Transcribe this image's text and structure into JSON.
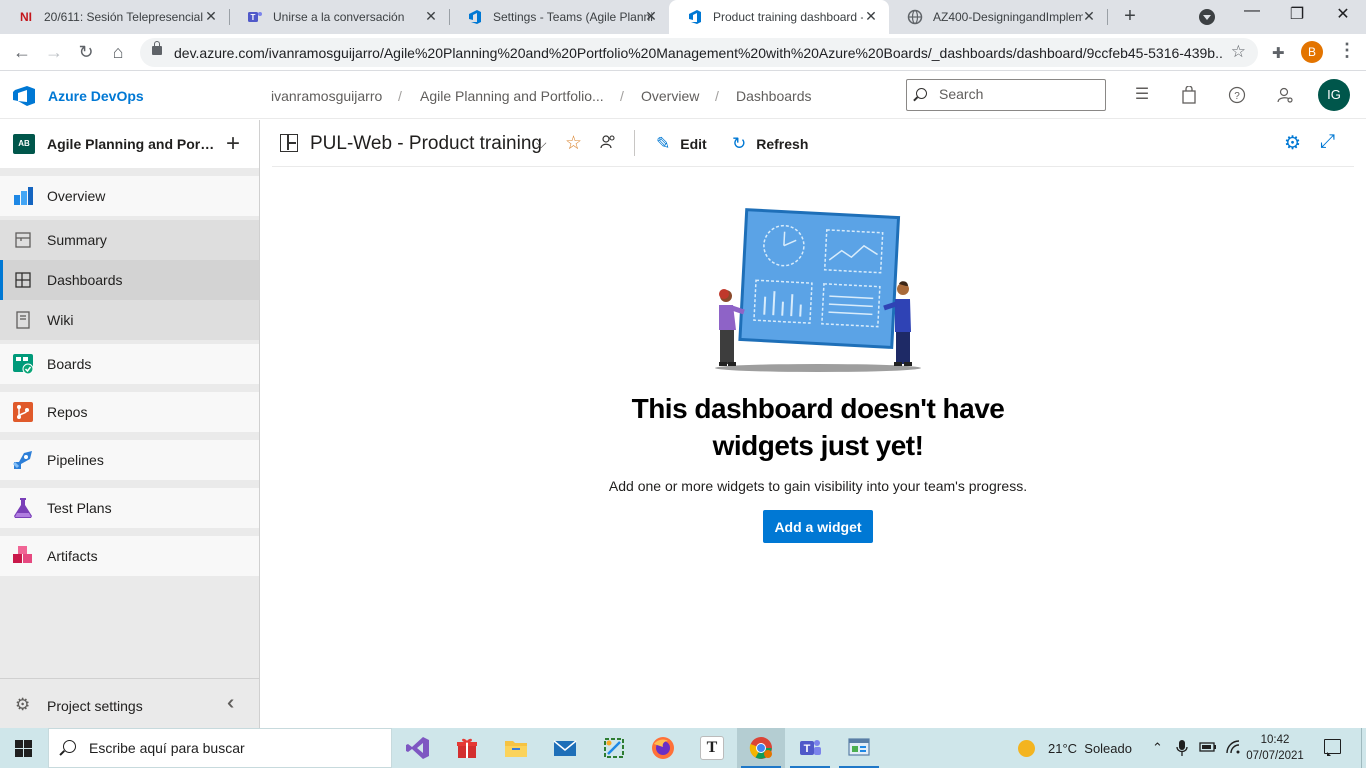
{
  "browser": {
    "tabs": [
      {
        "title": "20/611: Sesión Telepresencial",
        "icon": "notion-like-NI-icon",
        "favicon_text": "NI"
      },
      {
        "title": "Unirse a la conversación",
        "icon": "teams-icon"
      },
      {
        "title": "Settings - Teams (Agile Planni",
        "icon": "azure-devops-icon"
      },
      {
        "title": "Product training dashboard -",
        "icon": "azure-devops-icon"
      },
      {
        "title": "AZ400-DesigningandImplem",
        "icon": "globe-icon"
      }
    ],
    "active_tab_index": 3,
    "url": "dev.azure.com/ivanramosguijarro/Agile%20Planning%20and%20Portfolio%20Management%20with%20Azure%20Boards/_dashboards/dashboard/9ccfeb45-5316-439b...",
    "profile_initial": "B"
  },
  "header": {
    "product": "Azure DevOps",
    "breadcrumbs": [
      "ivanramosguijarro",
      "Agile Planning and Portfolio...",
      "Overview",
      "Dashboards"
    ],
    "search_placeholder": "Search",
    "user_initials": "IG"
  },
  "sidebar": {
    "project_initials": "AB",
    "project_name": "Agile Planning and Portfolio Management with Azure Boards",
    "items": [
      {
        "label": "Overview",
        "icon": "overview-icon"
      },
      {
        "label": "Summary",
        "icon": "summary-icon"
      },
      {
        "label": "Dashboards",
        "icon": "dashboards-icon"
      },
      {
        "label": "Wiki",
        "icon": "wiki-icon"
      },
      {
        "label": "Boards",
        "icon": "boards-icon"
      },
      {
        "label": "Repos",
        "icon": "repos-icon"
      },
      {
        "label": "Pipelines",
        "icon": "pipelines-icon"
      },
      {
        "label": "Test Plans",
        "icon": "test-plans-icon"
      },
      {
        "label": "Artifacts",
        "icon": "artifacts-icon"
      }
    ],
    "selected": "Dashboards",
    "settings_label": "Project settings"
  },
  "dashboard": {
    "title": "PUL-Web - Product training",
    "edit_label": "Edit",
    "refresh_label": "Refresh",
    "empty_title": "This dashboard doesn't have widgets just yet!",
    "empty_description": "Add one or more widgets to gain visibility into your team's progress.",
    "add_widget_label": "Add a widget"
  },
  "taskbar": {
    "search_placeholder": "Escribe aquí para buscar",
    "apps": [
      "visual-studio-icon",
      "gift-icon",
      "file-explorer-icon",
      "mail-icon",
      "snip-tool-icon",
      "firefox-icon",
      "typora-icon",
      "chrome-icon",
      "teams-icon",
      "control-panel-icon"
    ],
    "weather": "21°C  Soleado",
    "time": "10:42",
    "date": "07/07/2021"
  },
  "colors": {
    "accent": "#0078d4",
    "avatar": "#00564b",
    "tab_bg": "#dee1e6",
    "nav_bg": "#eaeaea"
  }
}
